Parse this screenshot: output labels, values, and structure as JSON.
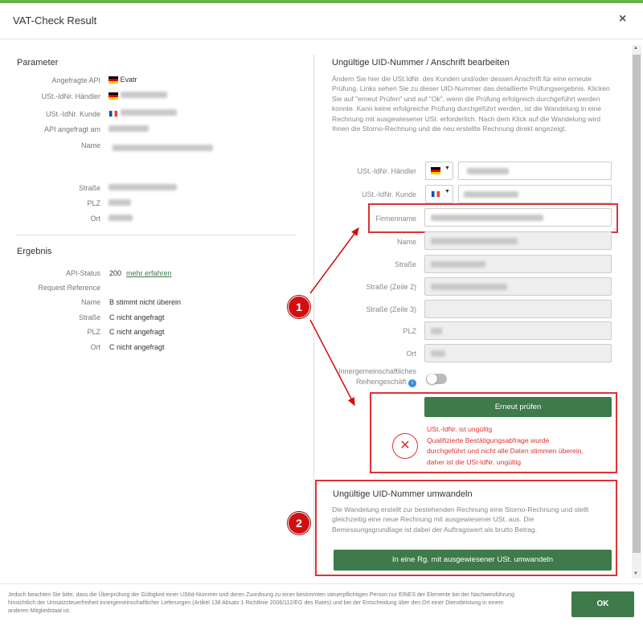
{
  "dialog": {
    "title": "VAT-Check Result",
    "close_icon": "×"
  },
  "param": {
    "heading": "Parameter",
    "rows": [
      {
        "label": "Angefragte API",
        "value": "Evatr",
        "flag": "de"
      },
      {
        "label": "USt.-IdNr. Händler",
        "value": "",
        "flag": "de"
      },
      {
        "label": "USt.-IdNr. Kunde",
        "value": "",
        "flag": "fr"
      },
      {
        "label": "API angefragt am",
        "value": ""
      },
      {
        "label": "Name",
        "value": ""
      },
      {
        "label": "Straße",
        "value": ""
      },
      {
        "label": "PLZ",
        "value": ""
      },
      {
        "label": "Ort",
        "value": ""
      }
    ]
  },
  "result": {
    "heading": "Ergebnis",
    "api_status_label": "API-Status",
    "api_status_value": "200",
    "more_link": "mehr erfahren",
    "request_ref_label": "Request Reference",
    "rows": [
      {
        "label": "Name",
        "code": "B",
        "text": "stimmt nicht überein"
      },
      {
        "label": "Straße",
        "code": "C",
        "text": "nicht angefragt"
      },
      {
        "label": "PLZ",
        "code": "C",
        "text": "nicht angefragt"
      },
      {
        "label": "Ort",
        "code": "C",
        "text": "nicht angefragt"
      }
    ]
  },
  "edit": {
    "heading": "Ungültige UID-Nummer / Anschrift bearbeiten",
    "description": "Ändern Sie hier die USt.IdNr. des Kunden und/oder dessen Anschrift für eine erneute Prüfung. Links sehen Sie zu dieser UID-Nummer das detaillierte Prüfungsergebnis. Klicken Sie auf \"erneut Prüfen\" und auf \"Ok\", wenn die Prüfung erfolgreich durchgeführt werden konnte. Kann keine erfolgreiche Prüfung durchgeführt werden, ist die Wandelung in eine Rechnung mit ausgewiesener USt. erforderlich. Nach dem Klick auf die Wandelung wird Ihnen die Storno-Rechnung und die neu erstellte Rechnung direkt angezeigt.",
    "fields": {
      "ustid_haendler": "USt.-IdNr. Händler",
      "ustid_kunde": "USt.-IdNr. Kunde",
      "firmenname": "Firmenname",
      "name": "Name",
      "strasse": "Straße",
      "strasse2": "Straße (Zeile 2)",
      "strasse3": "Straße (Zeile 3)",
      "plz": "PLZ",
      "ort": "Ort",
      "ig_line1": "Innergemeinschaftliches",
      "ig_line2": "Reihengeschäft"
    },
    "recheck_button": "Erneut prüfen",
    "error_lines": [
      "USt.-IdNr. ist ungültig",
      "Qualifizierte Bestätigungsabfrage wurde",
      "durchgeführt und nicht alle Daten stimmen überein,",
      "daher ist die USt-IdNr. ungültig"
    ]
  },
  "convert": {
    "heading": "Ungültige UID-Nummer umwandeln",
    "description": "Die Wandelung erstellt zur bestehenden Rechnung eine Storno-Rechnung und stellt gleichzeitig eine neue Rechnung mit ausgewiesener USt. aus. Die Bemessungsgrundlage ist dabei der Auftragswert als brutto Betrag.",
    "button": "In eine Rg. mit ausgewiesener USt. umwandeln"
  },
  "annotations": {
    "badge1": "1",
    "badge2": "2"
  },
  "footer": {
    "text": "Jedoch beachten Sie bitte, dass die Überprüfung der Gültigkeit einer UStId-Nummer und deren Zuordnung zu einer bestimmten steuerpflichtigen Person nur EINES der Elemente bei der Nachweisführung hinsichtlich der Umsatzsteuerfreiheit innergemeinschaftlicher Lieferungen (Artikel 138 Absatz 1 Richtlinie 2006/112/EG des Rates) und bei der Entscheidung über den Ort einer Dienstleistung in einem anderen Mitgliedstaat ist.",
    "ok_button": "OK"
  },
  "colors": {
    "accent": "#3f7a4a",
    "error": "#d33333",
    "topbar": "#6ab04c"
  }
}
